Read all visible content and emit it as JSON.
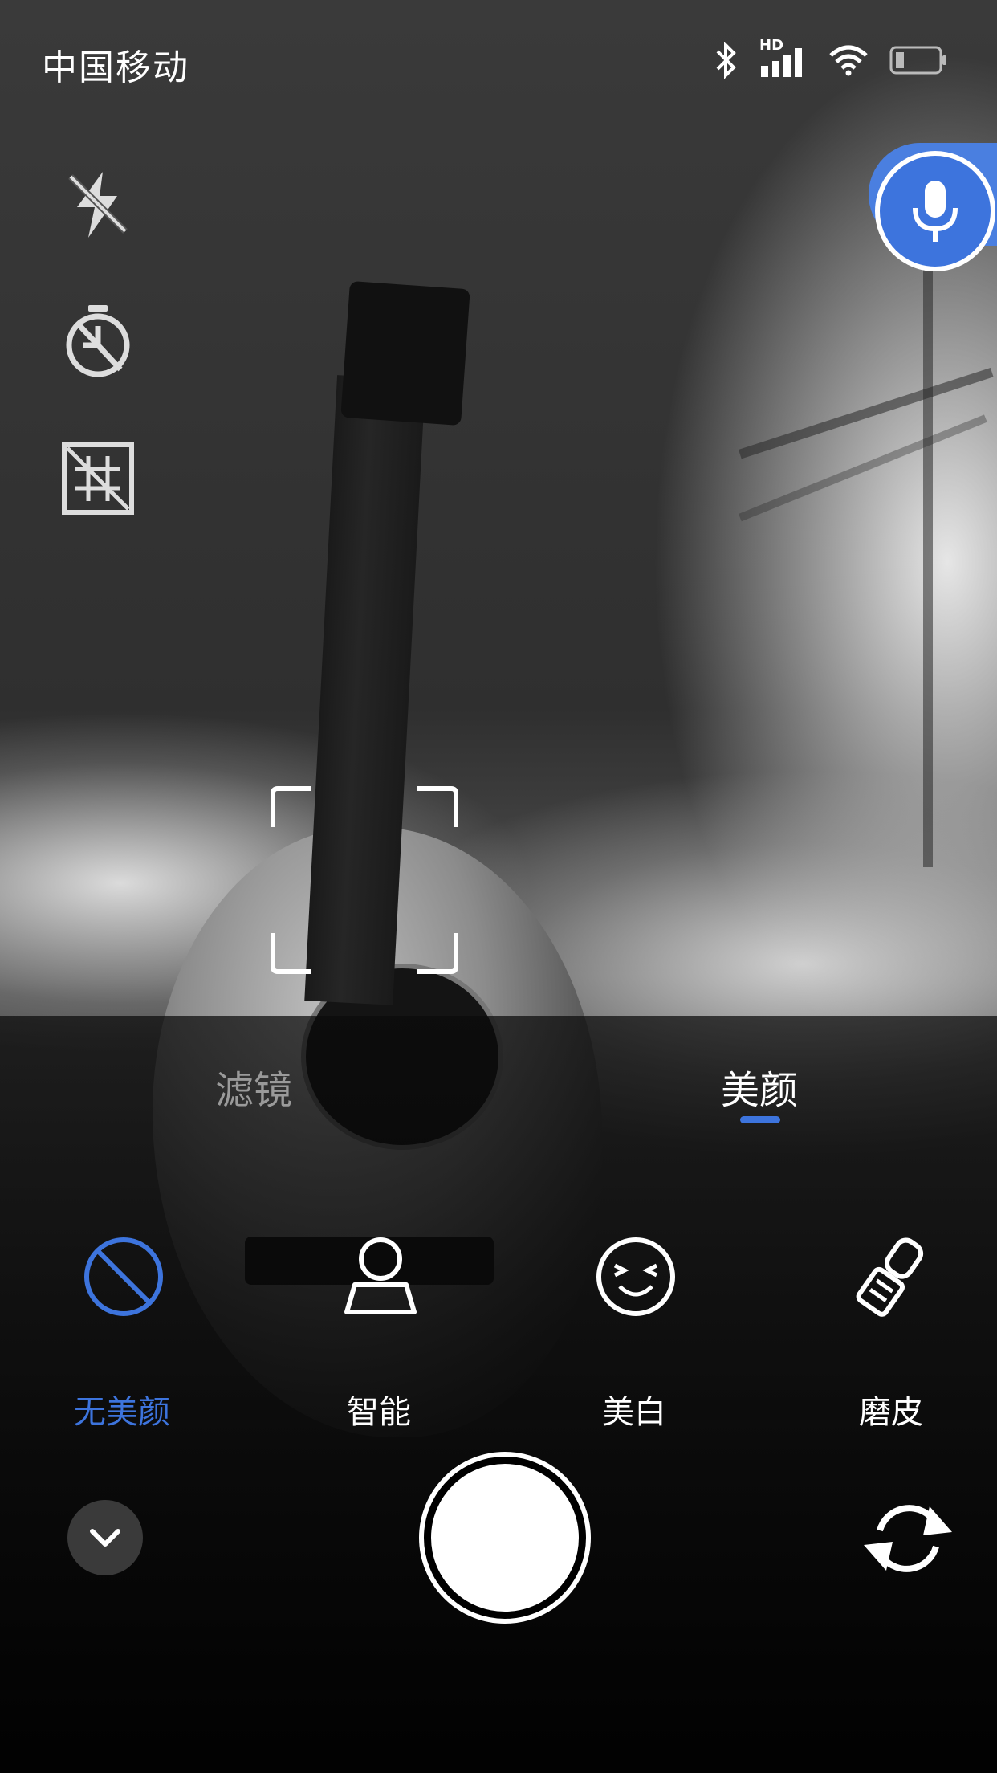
{
  "status_bar": {
    "carrier": "中国移动",
    "network_badge": "HD",
    "icons": [
      "bluetooth-icon",
      "signal-icon",
      "wifi-icon",
      "battery-icon"
    ]
  },
  "camera_tools": [
    {
      "name": "flash-off-icon"
    },
    {
      "name": "timer-off-icon"
    },
    {
      "name": "grid-off-icon"
    }
  ],
  "voice_button": {
    "icon": "microphone-icon",
    "color": "#3d74dd"
  },
  "tabs": [
    {
      "label": "滤镜",
      "active": false
    },
    {
      "label": "美颜",
      "active": true
    }
  ],
  "beauty_options": [
    {
      "label": "无美颜",
      "icon": "no-beauty-icon",
      "active": true
    },
    {
      "label": "智能",
      "icon": "person-icon",
      "active": false
    },
    {
      "label": "美白",
      "icon": "smile-face-icon",
      "active": false
    },
    {
      "label": "磨皮",
      "icon": "eraser-icon",
      "active": false
    }
  ],
  "controls": {
    "collapse": "chevron-down-icon",
    "shutter": "shutter-button",
    "switch_camera": "switch-camera-icon"
  },
  "colors": {
    "accent": "#3d74dd",
    "inactive_tab": "#9a9a9a"
  }
}
